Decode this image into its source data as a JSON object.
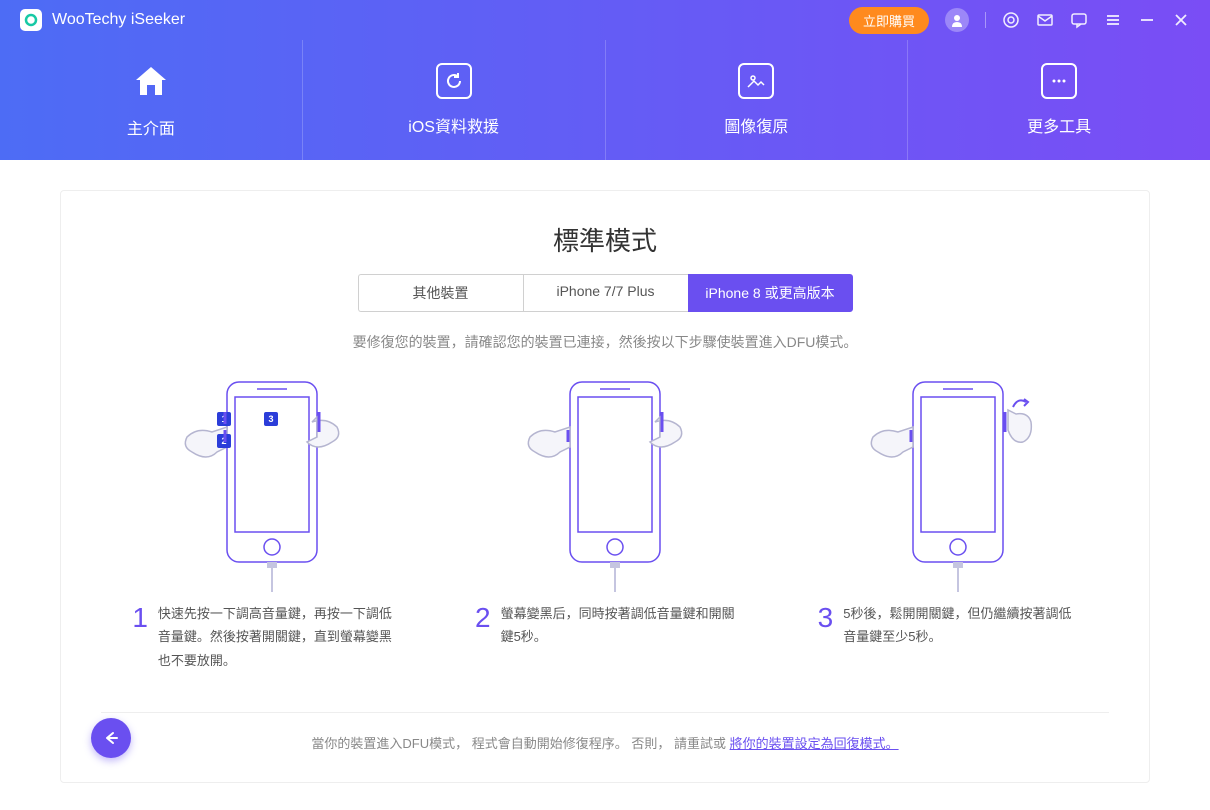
{
  "titlebar": {
    "app_name": "WooTechy iSeeker",
    "buy_label": "立即購買"
  },
  "nav": {
    "tabs": [
      {
        "label": "主介面"
      },
      {
        "label": "iOS資料救援"
      },
      {
        "label": "圖像復原"
      },
      {
        "label": "更多工具"
      }
    ]
  },
  "content": {
    "mode_title": "標準模式",
    "device_tabs": [
      {
        "label": "其他裝置"
      },
      {
        "label": "iPhone 7/7 Plus"
      },
      {
        "label": "iPhone 8 或更高版本"
      }
    ],
    "instruction": "要修復您的裝置，請確認您的裝置已連接，然後按以下步驟使裝置進入DFU模式。",
    "steps": [
      {
        "num": "1",
        "desc": "快速先按一下調高音量鍵，再按一下調低音量鍵。然後按著開關鍵，直到螢幕變黑也不要放開。"
      },
      {
        "num": "2",
        "desc": "螢幕變黑后，同時按著調低音量鍵和開關鍵5秒。"
      },
      {
        "num": "3",
        "desc": "5秒後，鬆開開關鍵，但仍繼續按著調低音量鍵至少5秒。"
      }
    ],
    "footer": {
      "prefix": "當你的裝置進入DFU模式， 程式會自動開始修復程序。 否則， 請重試或",
      "link": "將你的裝置設定為回復模式。"
    }
  }
}
